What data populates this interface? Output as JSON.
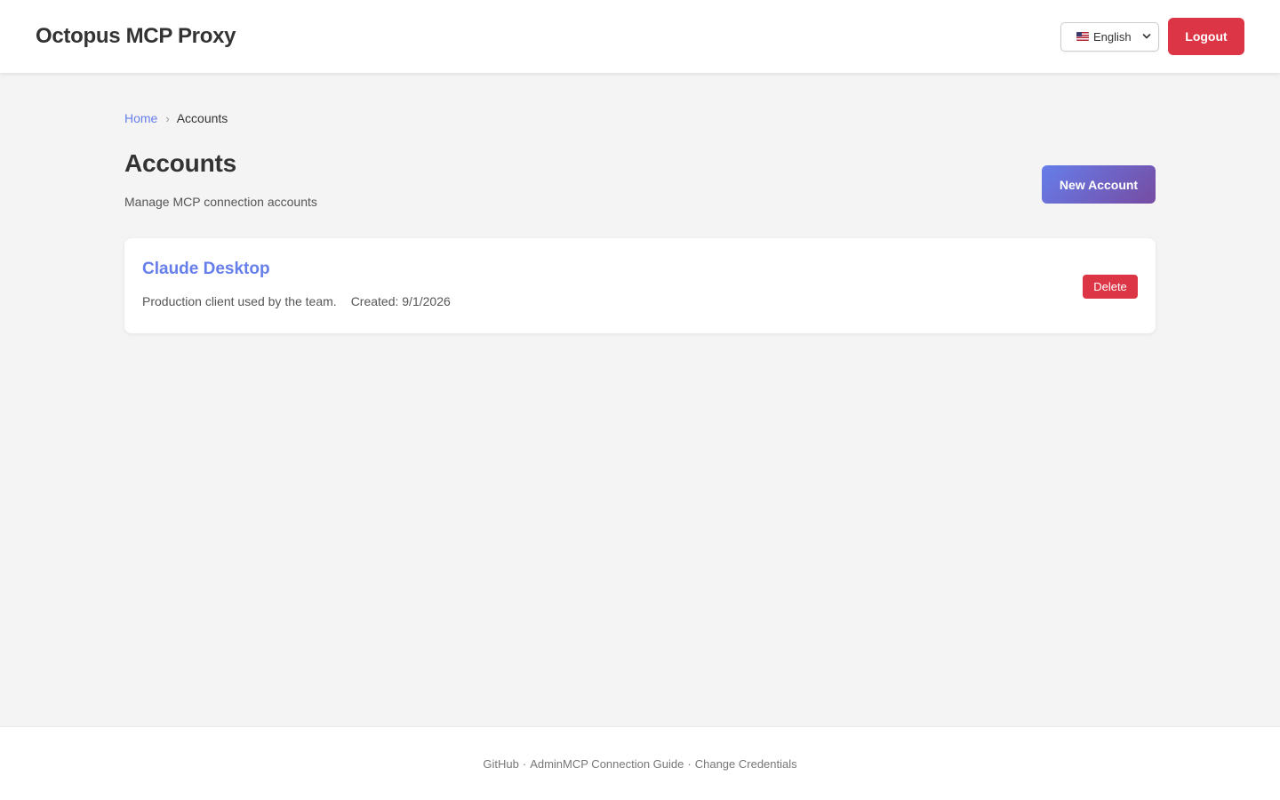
{
  "header": {
    "app_title": "Octopus MCP Proxy",
    "language": {
      "selected": "English",
      "flag": "us-flag-icon"
    },
    "logout_label": "Logout"
  },
  "breadcrumb": {
    "home": "Home",
    "separator": "›",
    "current": "Accounts"
  },
  "page": {
    "title": "Accounts",
    "subtitle": "Manage MCP connection accounts",
    "new_button_label": "New Account"
  },
  "accounts": [
    {
      "name": "Claude Desktop",
      "description": "Production client used by the team.",
      "created": "Created: 9/1/2026",
      "delete_label": "Delete"
    }
  ],
  "footer": {
    "github": "GitHub",
    "sep1": "·",
    "admin_guide": "AdminMCP Connection Guide",
    "sep2": "·",
    "change_credentials": "Change Credentials"
  },
  "colors": {
    "accent": "#667eea",
    "accent_end": "#764ba2",
    "danger": "#dc3545",
    "background": "#f4f4f4"
  }
}
